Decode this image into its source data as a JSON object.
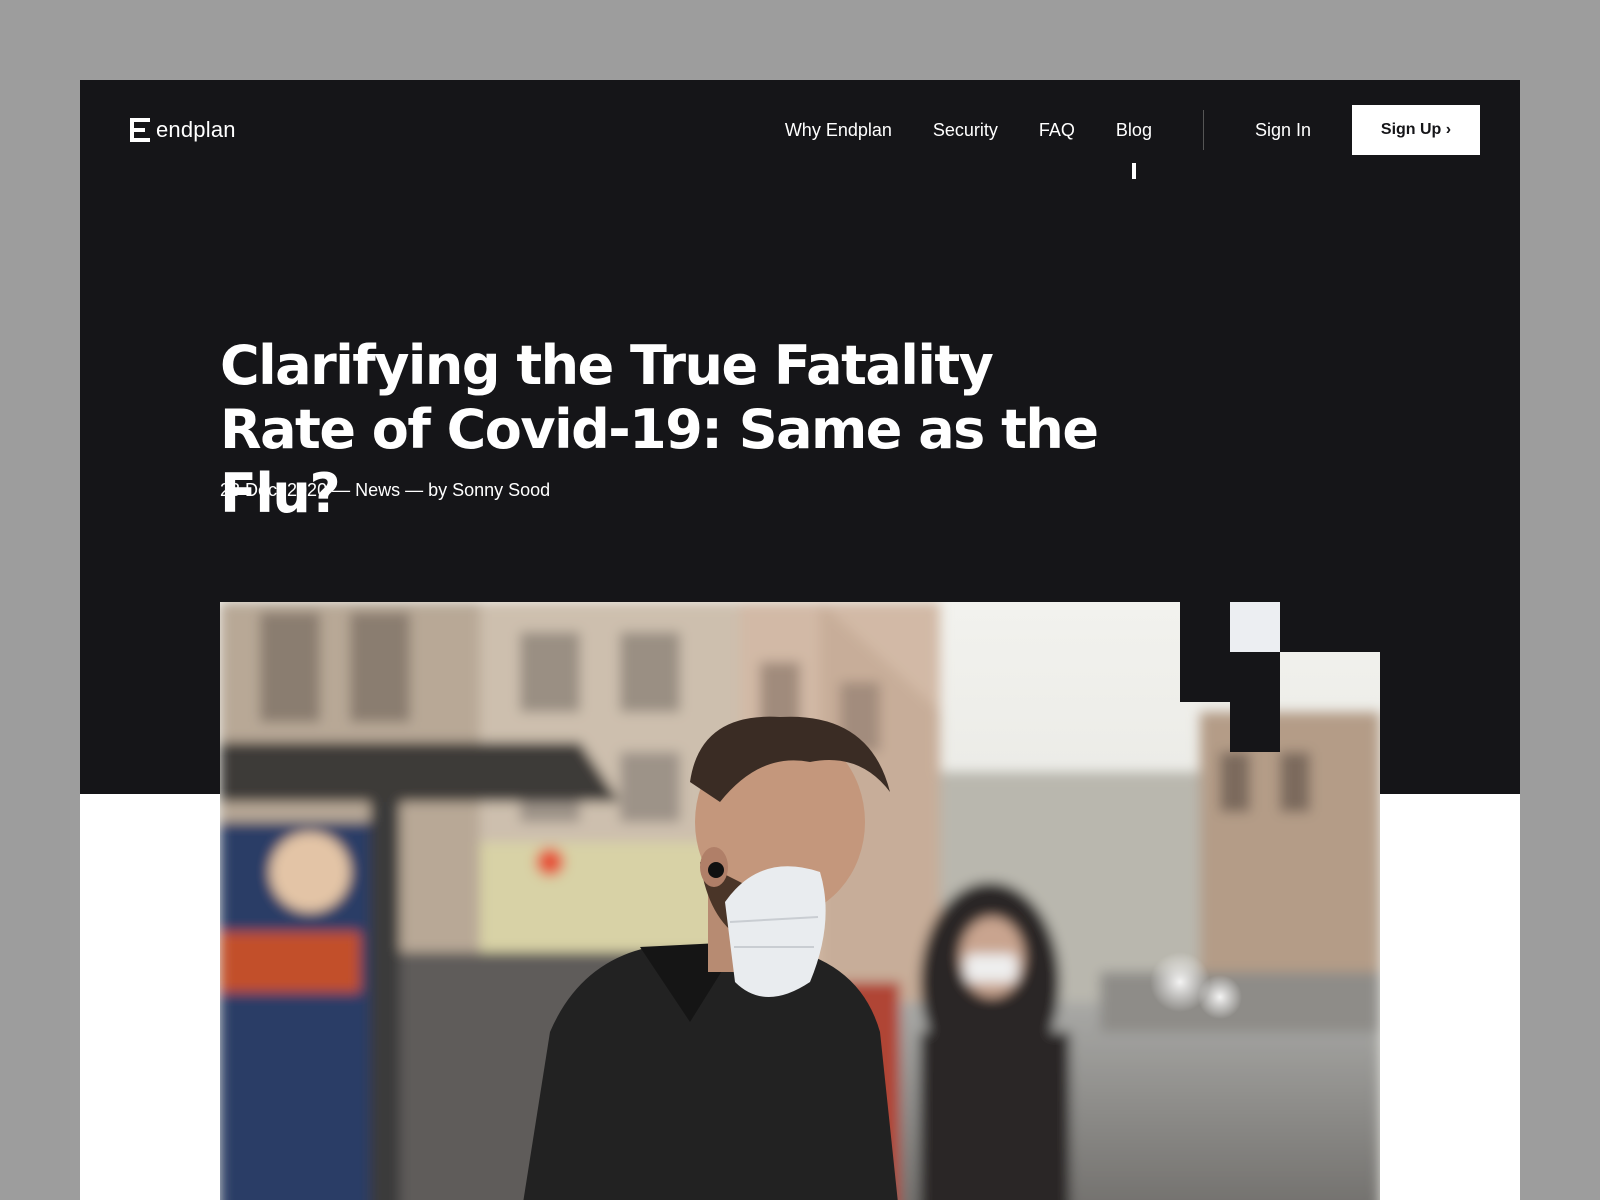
{
  "brand": {
    "name": "endplan",
    "logo_icon": "endplan-logo-icon"
  },
  "nav": {
    "items": [
      {
        "label": "Why Endplan"
      },
      {
        "label": "Security"
      },
      {
        "label": "FAQ"
      },
      {
        "label": "Blog",
        "active": true
      }
    ],
    "sign_in": "Sign In",
    "sign_up": "Sign Up ›"
  },
  "article": {
    "title": "Clarifying the True Fatality Rate of Covid-19: Same as the Flu?",
    "meta": "23 Dec, 2020 — News — by Sonny Sood"
  },
  "hero_image": {
    "subject": "hero-photo"
  },
  "colors": {
    "hero_bg": "#151518",
    "page_bg": "#9d9d9d",
    "content_bg": "#ffffff",
    "button_bg": "#ffffff",
    "button_text": "#151518"
  }
}
